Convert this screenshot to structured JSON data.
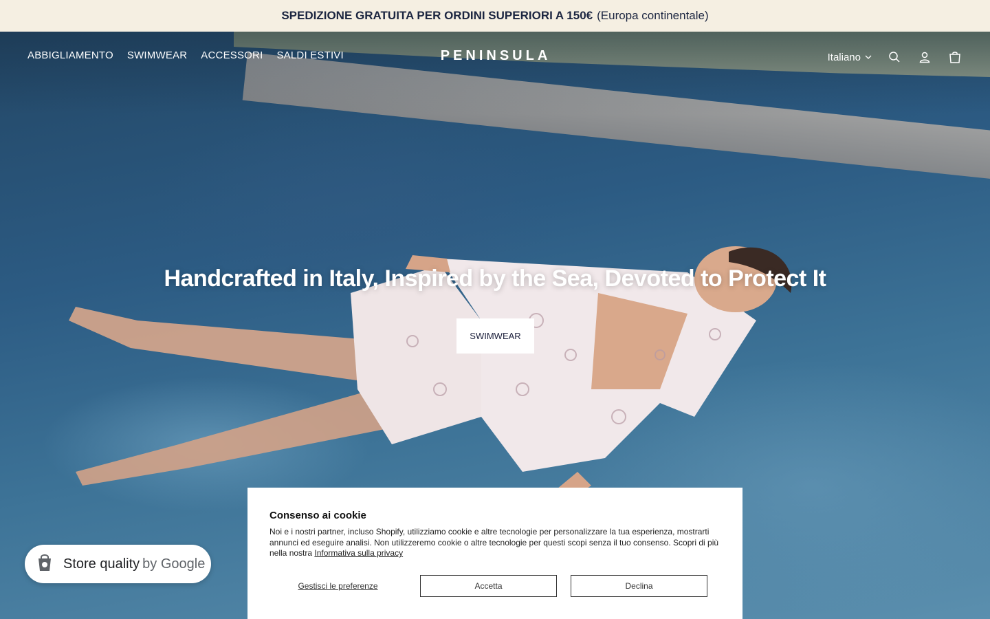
{
  "announcement": {
    "bold": "SPEDIZIONE GRATUITA PER ORDINI SUPERIORI A 150€",
    "regular": "(Europa continentale)"
  },
  "header": {
    "nav": [
      "ABBIGLIAMENTO",
      "SWIMWEAR",
      "ACCESSORI",
      "SALDI ESTIVI"
    ],
    "logo": "PENINSULA",
    "language": "Italiano",
    "icons": [
      "search-icon",
      "account-icon",
      "cart-icon"
    ]
  },
  "hero": {
    "title": "Handcrafted in Italy, Inspired by the Sea, Devoted to Protect It",
    "button": "SWIMWEAR"
  },
  "google_badge": {
    "label": "Store quality",
    "suffix": "by Google"
  },
  "cookie": {
    "title": "Consenso ai cookie",
    "text": "Noi e i nostri partner, incluso Shopify, utilizziamo cookie e altre tecnologie per personalizzare la tua esperienza, mostrarti annunci ed eseguire analisi. Non utilizzeremo cookie o altre tecnologie per questi scopi senza il tuo consenso. Scopri di più nella nostra",
    "link": "Informativa sulla privacy",
    "manage": "Gestisci le preferenze",
    "accept": "Accetta",
    "decline": "Declina"
  },
  "colors": {
    "announce_bg": "#f5efe2",
    "text_dark": "#1b1f3b",
    "water": "#2c5b83"
  }
}
